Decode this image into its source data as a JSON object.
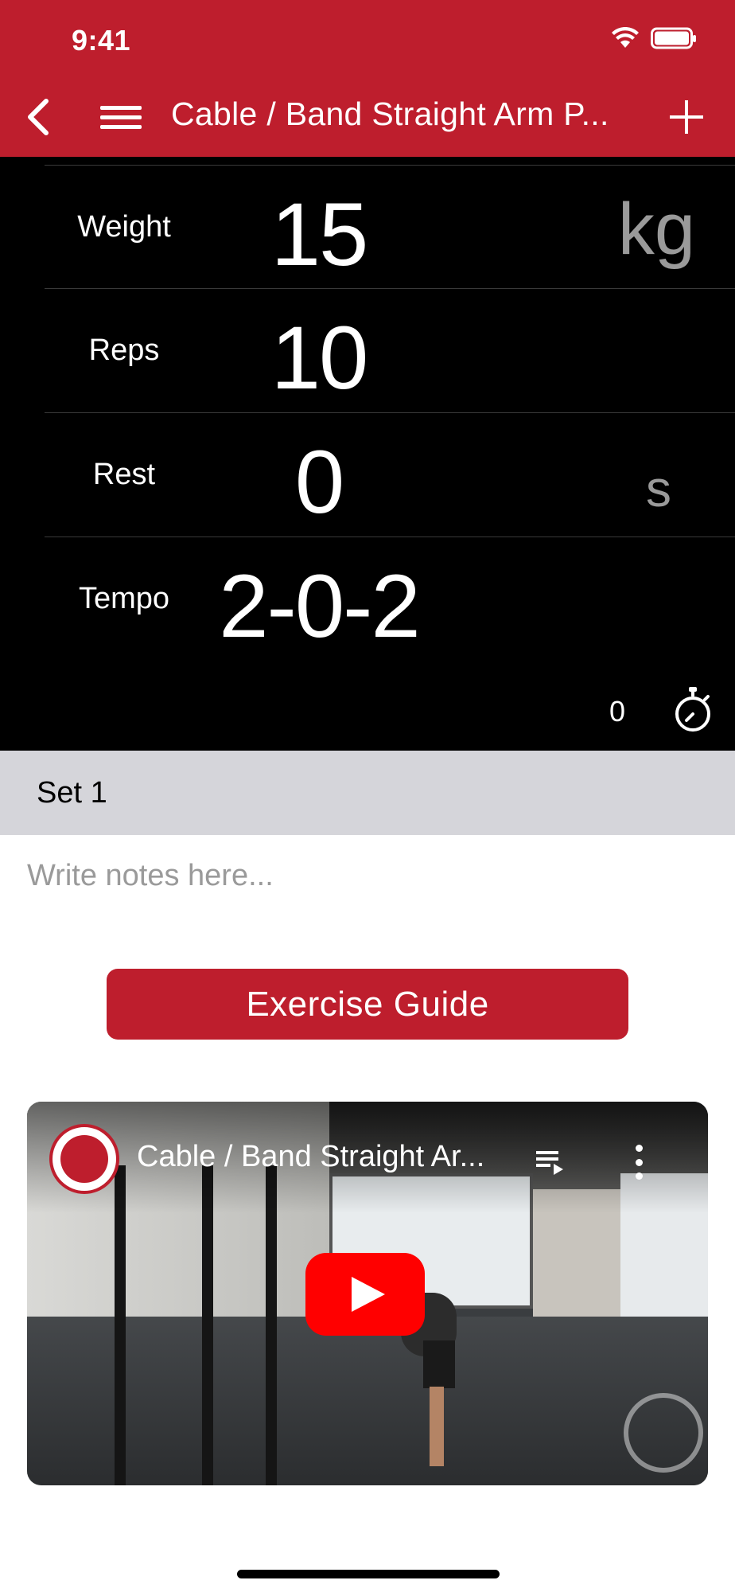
{
  "status_bar": {
    "time": "9:41",
    "icons": [
      "wifi-icon",
      "battery-icon"
    ]
  },
  "nav": {
    "title": "Cable / Band Straight Arm P...",
    "back_icon": "chevron-left-icon",
    "menu_icon": "hamburger-menu-icon",
    "add_icon": "plus-icon"
  },
  "metrics": [
    {
      "label": "Weight",
      "value": "15",
      "unit": "kg"
    },
    {
      "label": "Reps",
      "value": "10",
      "unit": ""
    },
    {
      "label": "Rest",
      "value": "0",
      "unit": "s"
    },
    {
      "label": "Tempo",
      "value": "2-0-2",
      "unit": ""
    }
  ],
  "timer": {
    "count": "0",
    "icon": "stopwatch-icon"
  },
  "set": {
    "label": "Set 1"
  },
  "notes": {
    "placeholder": "Write notes here...",
    "value": ""
  },
  "guide_button": {
    "label": "Exercise Guide"
  },
  "video": {
    "title": "Cable / Band Straight Ar...",
    "channel_logo_icon": "channel-logo-icon",
    "playlist_icon": "playlist-icon",
    "more_icon": "more-vertical-icon",
    "play_icon": "youtube-play-icon"
  },
  "colors": {
    "brand": "#be1e2d",
    "panel": "#000000",
    "set_header": "#d5d5da",
    "unit_gray": "#9a9a9a"
  }
}
